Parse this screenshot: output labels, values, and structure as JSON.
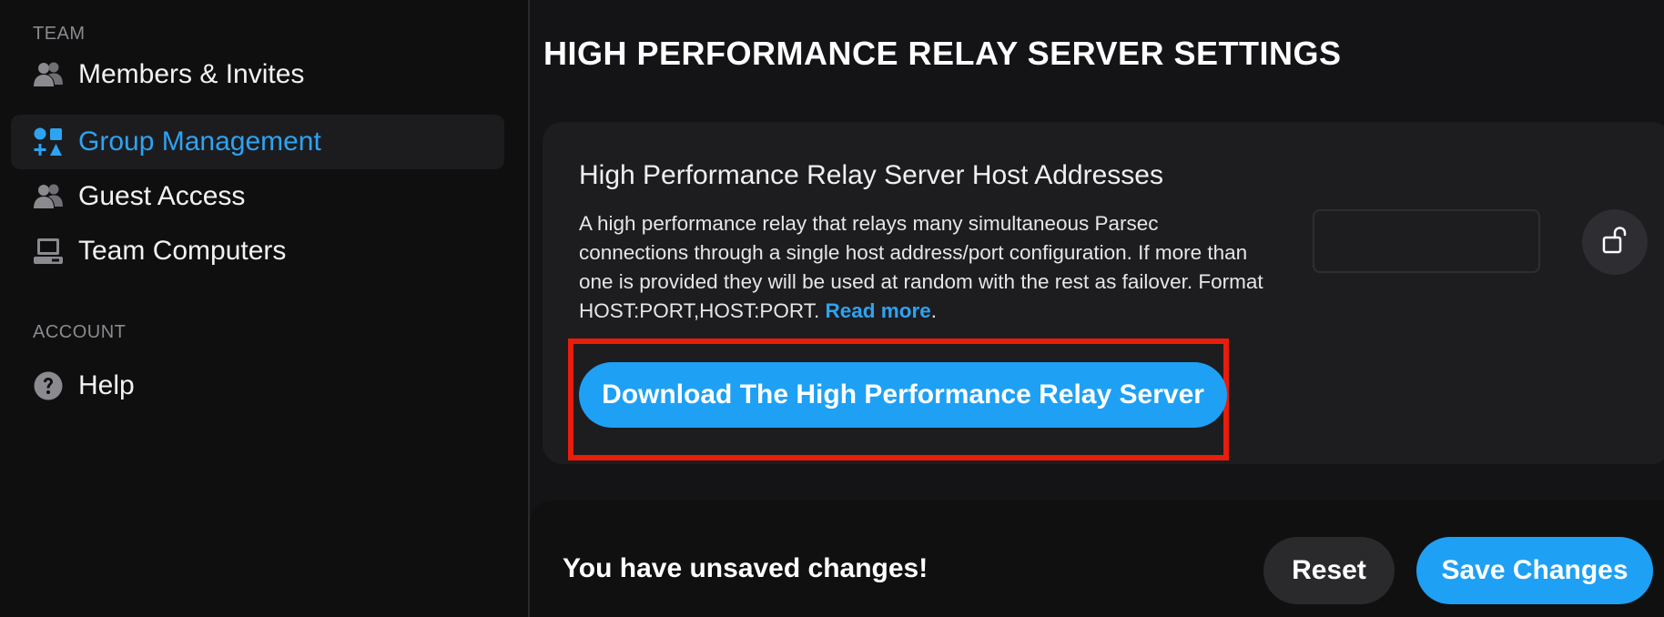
{
  "sidebar": {
    "team_label": "TEAM",
    "account_label": "ACCOUNT",
    "items": [
      {
        "label": "Members & Invites",
        "icon": "users-icon",
        "active": false
      },
      {
        "label": "Group Management",
        "icon": "shapes-icon",
        "active": true
      },
      {
        "label": "Guest Access",
        "icon": "users-icon",
        "active": false
      },
      {
        "label": "Team Computers",
        "icon": "computer-icon",
        "active": false
      }
    ],
    "account_items": [
      {
        "label": "Help",
        "icon": "help-icon"
      }
    ]
  },
  "main": {
    "title": "HIGH PERFORMANCE RELAY SERVER SETTINGS",
    "card": {
      "title": "High Performance Relay Server Host Addresses",
      "description": "A high performance relay that relays many simultaneous Parsec connections through a single host address/port configuration. If more than one is provided they will be used at random with the rest as failover. Format HOST:PORT,HOST:PORT.",
      "read_more": "Read more",
      "period": ".",
      "input_value": "",
      "lock_icon": "unlock-icon",
      "download_label": "Download The High Performance Relay Server"
    }
  },
  "unsaved": {
    "message": "You have unsaved changes!",
    "reset_label": "Reset",
    "save_label": "Save Changes"
  },
  "colors": {
    "accent": "#1ea0f5",
    "active_text": "#2ea3f2",
    "highlight": "#ea1c0a"
  }
}
